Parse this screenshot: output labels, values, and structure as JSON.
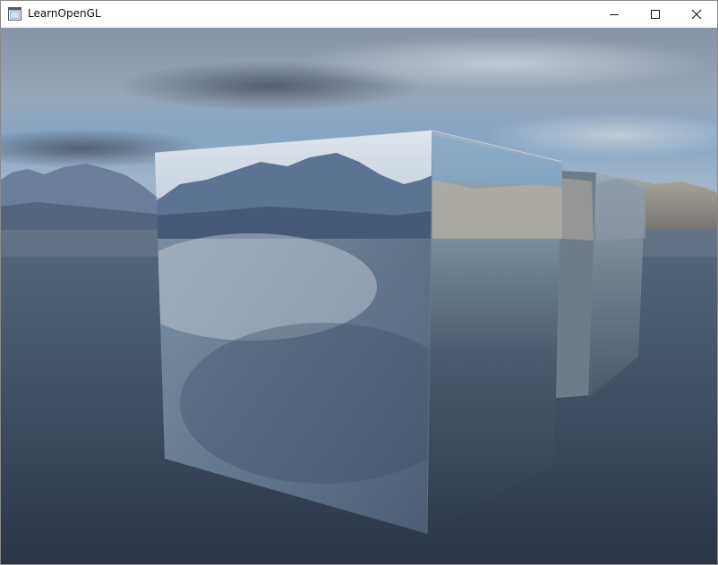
{
  "window": {
    "title": "LearnOpenGL",
    "icon": "application-window-icon"
  },
  "titlebar_buttons": [
    {
      "name": "minimize",
      "icon": "minimize-icon"
    },
    {
      "name": "maximize",
      "icon": "maximize-icon"
    },
    {
      "name": "close",
      "icon": "close-icon"
    }
  ],
  "scene": {
    "description_colors": {
      "sky_top": "#7f8da0",
      "sky_blue": "#6e9cc4",
      "water": "#3b4d63",
      "mountain": "#7284a0"
    }
  }
}
